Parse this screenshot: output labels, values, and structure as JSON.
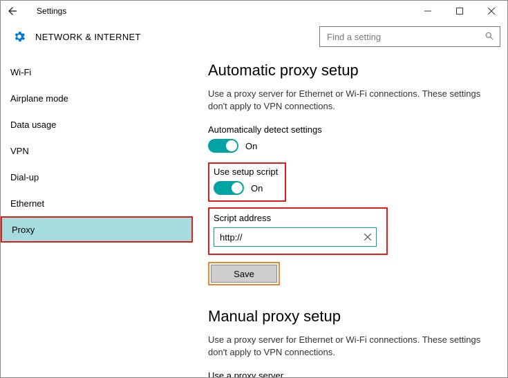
{
  "window": {
    "title": "Settings"
  },
  "header": {
    "section": "NETWORK & INTERNET",
    "search_placeholder": "Find a setting"
  },
  "sidebar": {
    "items": [
      {
        "label": "Wi-Fi"
      },
      {
        "label": "Airplane mode"
      },
      {
        "label": "Data usage"
      },
      {
        "label": "VPN"
      },
      {
        "label": "Dial-up"
      },
      {
        "label": "Ethernet"
      },
      {
        "label": "Proxy"
      }
    ],
    "selected_index": 6
  },
  "content": {
    "auto_section_title": "Automatic proxy setup",
    "auto_desc": "Use a proxy server for Ethernet or Wi-Fi connections. These settings don't apply to VPN connections.",
    "auto_detect_label": "Automatically detect settings",
    "auto_detect_state": "On",
    "use_script_label": "Use setup script",
    "use_script_state": "On",
    "script_addr_label": "Script address",
    "script_addr_value": "http://",
    "save_label": "Save",
    "manual_section_title": "Manual proxy setup",
    "manual_desc": "Use a proxy server for Ethernet or Wi-Fi connections. These settings don't apply to VPN connections.",
    "use_proxy_label": "Use a proxy server"
  },
  "colors": {
    "accent": "#00a4a6",
    "highlight_red": "#e21b1b",
    "highlight_orange": "#e98a2b"
  }
}
